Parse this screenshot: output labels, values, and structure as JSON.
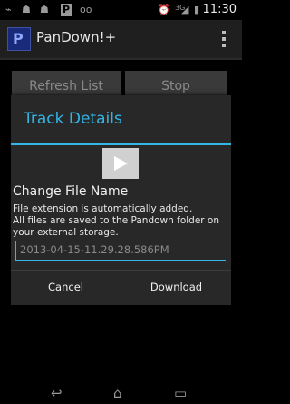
{
  "status_bar": {
    "time": "11:30",
    "network": "3G",
    "left_icons": [
      "usb-icon",
      "android-icon",
      "pandora-icon",
      "voicemail-icon"
    ],
    "right_icons": [
      "alarm-icon",
      "signal-icon",
      "battery-icon"
    ]
  },
  "app": {
    "title": "PanDown!+",
    "icon_letter": "P"
  },
  "background_buttons": {
    "refresh": "Refresh List",
    "stop": "Stop"
  },
  "dialog": {
    "title": "Track Details",
    "change_label": "Change File Name",
    "note_line1": "File extension is automatically added.",
    "note_line2": "All files are saved to the Pandown folder on your external storage.",
    "filename_placeholder": "2013-04-15-11.29.28.586PM",
    "cancel": "Cancel",
    "download": "Download"
  },
  "colors": {
    "accent": "#33b5e5",
    "dialog_bg": "#282828"
  }
}
